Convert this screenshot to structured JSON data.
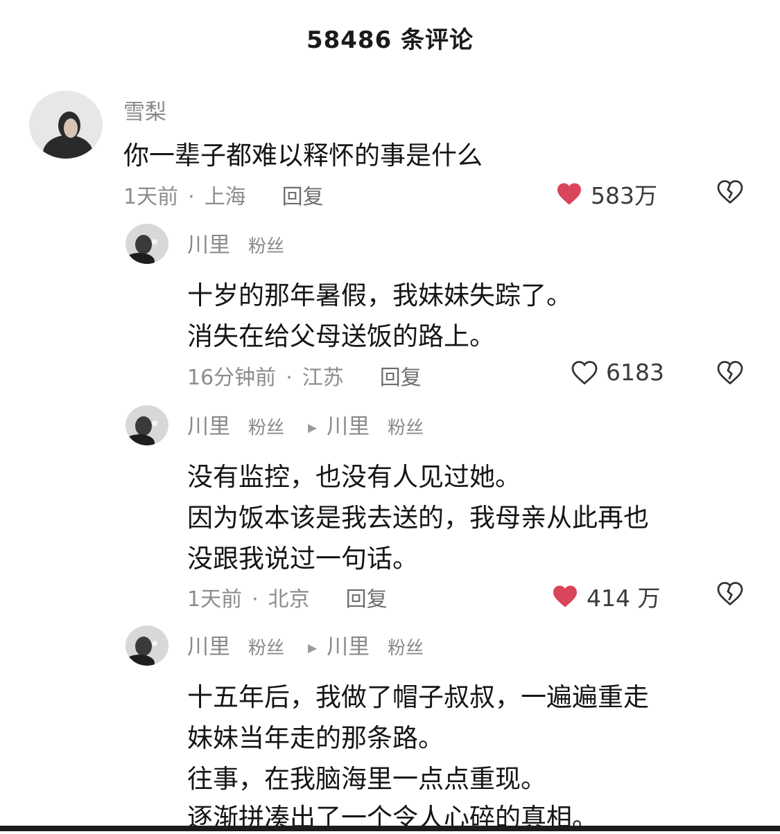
{
  "header": {
    "comment_count_title": "58486 条评论"
  },
  "comments": [
    {
      "username": "雪梨",
      "lines": [
        "你一辈子都难以释怀的事是什么"
      ],
      "time": "1天前",
      "location": "上海",
      "reply_label": "回复",
      "likes": "583万",
      "liked": true
    },
    {
      "username": "川里",
      "fan_tag": "粉丝",
      "lines": [
        "十岁的那年暑假，我妹妹失踪了。",
        "消失在给父母送饭的路上。"
      ],
      "time": "16分钟前",
      "location": "江苏",
      "reply_label": "回复",
      "likes": "6183",
      "liked": false
    },
    {
      "username": "川里",
      "fan_tag": "粉丝",
      "reply_to": "川里",
      "reply_to_tag": "粉丝",
      "lines": [
        "没有监控，也没有人见过她。",
        "因为饭本该是我去送的，我母亲从此再也",
        "没跟我说过一句话。"
      ],
      "time": "1天前",
      "location": "北京",
      "reply_label": "回复",
      "likes": "414 万",
      "liked": true
    },
    {
      "username": "川里",
      "fan_tag": "粉丝",
      "reply_to": "川里",
      "reply_to_tag": "粉丝",
      "lines": [
        "十五年后，我做了帽子叔叔，一遍遍重走",
        "妹妹当年走的那条路。",
        "往事，在我脑海里一点点重现。",
        "逐渐拼凑出了一个令人心碎的真相。"
      ]
    }
  ],
  "colors": {
    "like_active": "#d9455a",
    "text_secondary": "#8a8a8a"
  }
}
